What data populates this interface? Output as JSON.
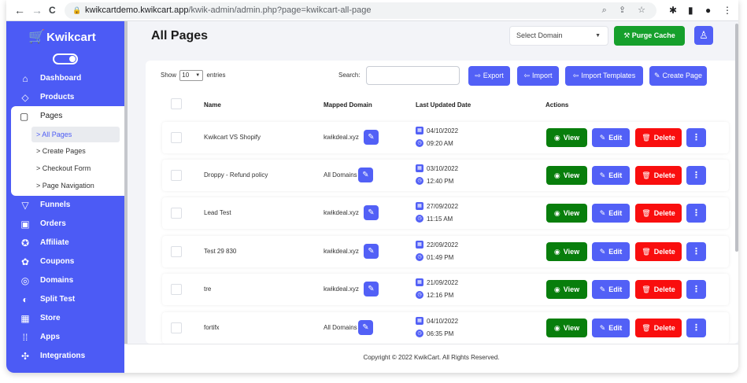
{
  "browser": {
    "back": "←",
    "forward": "→",
    "reload": "C",
    "url_host": "kwikcartdemo.kwikcart.app",
    "url_path": "/kwik-admin/admin.php?page=kwikcart-all-page",
    "right_icons": "⌕ ⇪ ☆"
  },
  "sidebar": {
    "logo": "Kwikcart",
    "items_top": [
      {
        "label": "Dashboard",
        "icon": "⌂"
      },
      {
        "label": "Products",
        "icon": "◇"
      }
    ],
    "pages": {
      "label": "Pages",
      "icon": "▢",
      "sub": [
        {
          "label": "> All Pages"
        },
        {
          "label": "> Create Pages"
        },
        {
          "label": "> Checkout Form"
        },
        {
          "label": "> Page Navigation"
        }
      ]
    },
    "items_bottom": [
      {
        "label": "Funnels",
        "icon": "▽"
      },
      {
        "label": "Orders",
        "icon": "▣"
      },
      {
        "label": "Affiliate",
        "icon": "✪"
      },
      {
        "label": "Coupons",
        "icon": "✿"
      },
      {
        "label": "Domains",
        "icon": "◎"
      },
      {
        "label": "Split Test",
        "icon": "◐"
      },
      {
        "label": "Store",
        "icon": "▦"
      },
      {
        "label": "Apps",
        "icon": "⁞⁞"
      },
      {
        "label": "Integrations",
        "icon": "✣"
      }
    ]
  },
  "header": {
    "title": "All Pages",
    "select_domain": "Select Domain",
    "purge_cache": "Purge Cache",
    "purge_icon": "⚒",
    "user_icon": "♙"
  },
  "toolbar": {
    "show": "Show",
    "entries_value": "10",
    "entries": "entries",
    "search_label": "Search:",
    "export": "Export",
    "import": "Import",
    "import_templates": "Import Templates",
    "create_page": "Create Page"
  },
  "table": {
    "headers": [
      "Name",
      "Mapped Domain",
      "Last Updated Date",
      "Actions"
    ],
    "view_label": "View",
    "edit_label": "Edit",
    "delete_label": "Delete",
    "rows": [
      {
        "name": "Kwikcart VS Shopify",
        "domain": "kwikdeal.xyz",
        "date": "04/10/2022",
        "time": "09:20 AM"
      },
      {
        "name": "Droppy - Refund policy",
        "domain": "All Domains",
        "date": "03/10/2022",
        "time": "12:40 PM"
      },
      {
        "name": "Lead Test",
        "domain": "kwikdeal.xyz",
        "date": "27/09/2022",
        "time": "11:15 AM"
      },
      {
        "name": "Test 29 830",
        "domain": "kwikdeal.xyz",
        "date": "22/09/2022",
        "time": "01:49 PM"
      },
      {
        "name": "tre",
        "domain": "kwikdeal.xyz",
        "date": "21/09/2022",
        "time": "12:16 PM"
      },
      {
        "name": "fortifx",
        "domain": "All Domains",
        "date": "04/10/2022",
        "time": "06:35 PM"
      }
    ]
  },
  "footer": {
    "copyright": "Copyright © 2022 KwikCart. All Rights Reserved."
  },
  "colors": {
    "primary": "#4c5bf5",
    "green": "#087e0c",
    "red": "#f90e0e"
  }
}
